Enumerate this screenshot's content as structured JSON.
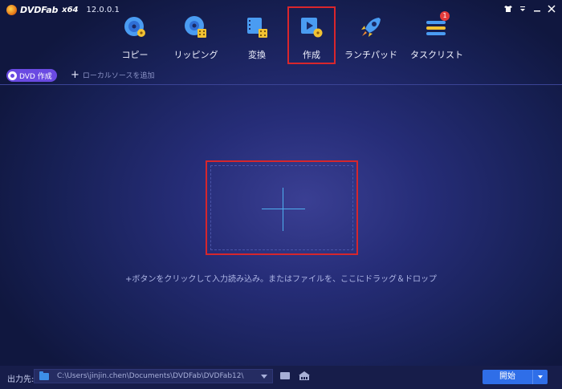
{
  "app": {
    "brand_name": "DVDFab",
    "arch": "x64",
    "version": "12.0.0.1"
  },
  "nav": {
    "items": [
      {
        "label": "コピー",
        "icon": "copy-disc-icon"
      },
      {
        "label": "リッピング",
        "icon": "ripper-icon"
      },
      {
        "label": "変換",
        "icon": "converter-icon"
      },
      {
        "label": "作成",
        "icon": "creator-icon",
        "selected": true
      },
      {
        "label": "ランチパッド",
        "icon": "launchpad-rocket-icon"
      },
      {
        "label": "タスクリスト",
        "icon": "task-list-icon",
        "badge": "1"
      }
    ]
  },
  "toolbar": {
    "dvd_button": "DVD 作成",
    "add_local": "ローカルソースを追加"
  },
  "main": {
    "hint": "+ボタンをクリックして入力読み込み。またはファイルを、ここにドラッグ＆ドロップ"
  },
  "footer": {
    "output_label": "出力先:",
    "output_path": "C:\\Users\\jinjin.chen\\Documents\\DVDFab\\DVDFab12\\",
    "start_label": "開始"
  },
  "colors": {
    "accent": "#2f6ee8",
    "highlight": "#d6262c",
    "dvd_button": "#6a4ae2"
  }
}
